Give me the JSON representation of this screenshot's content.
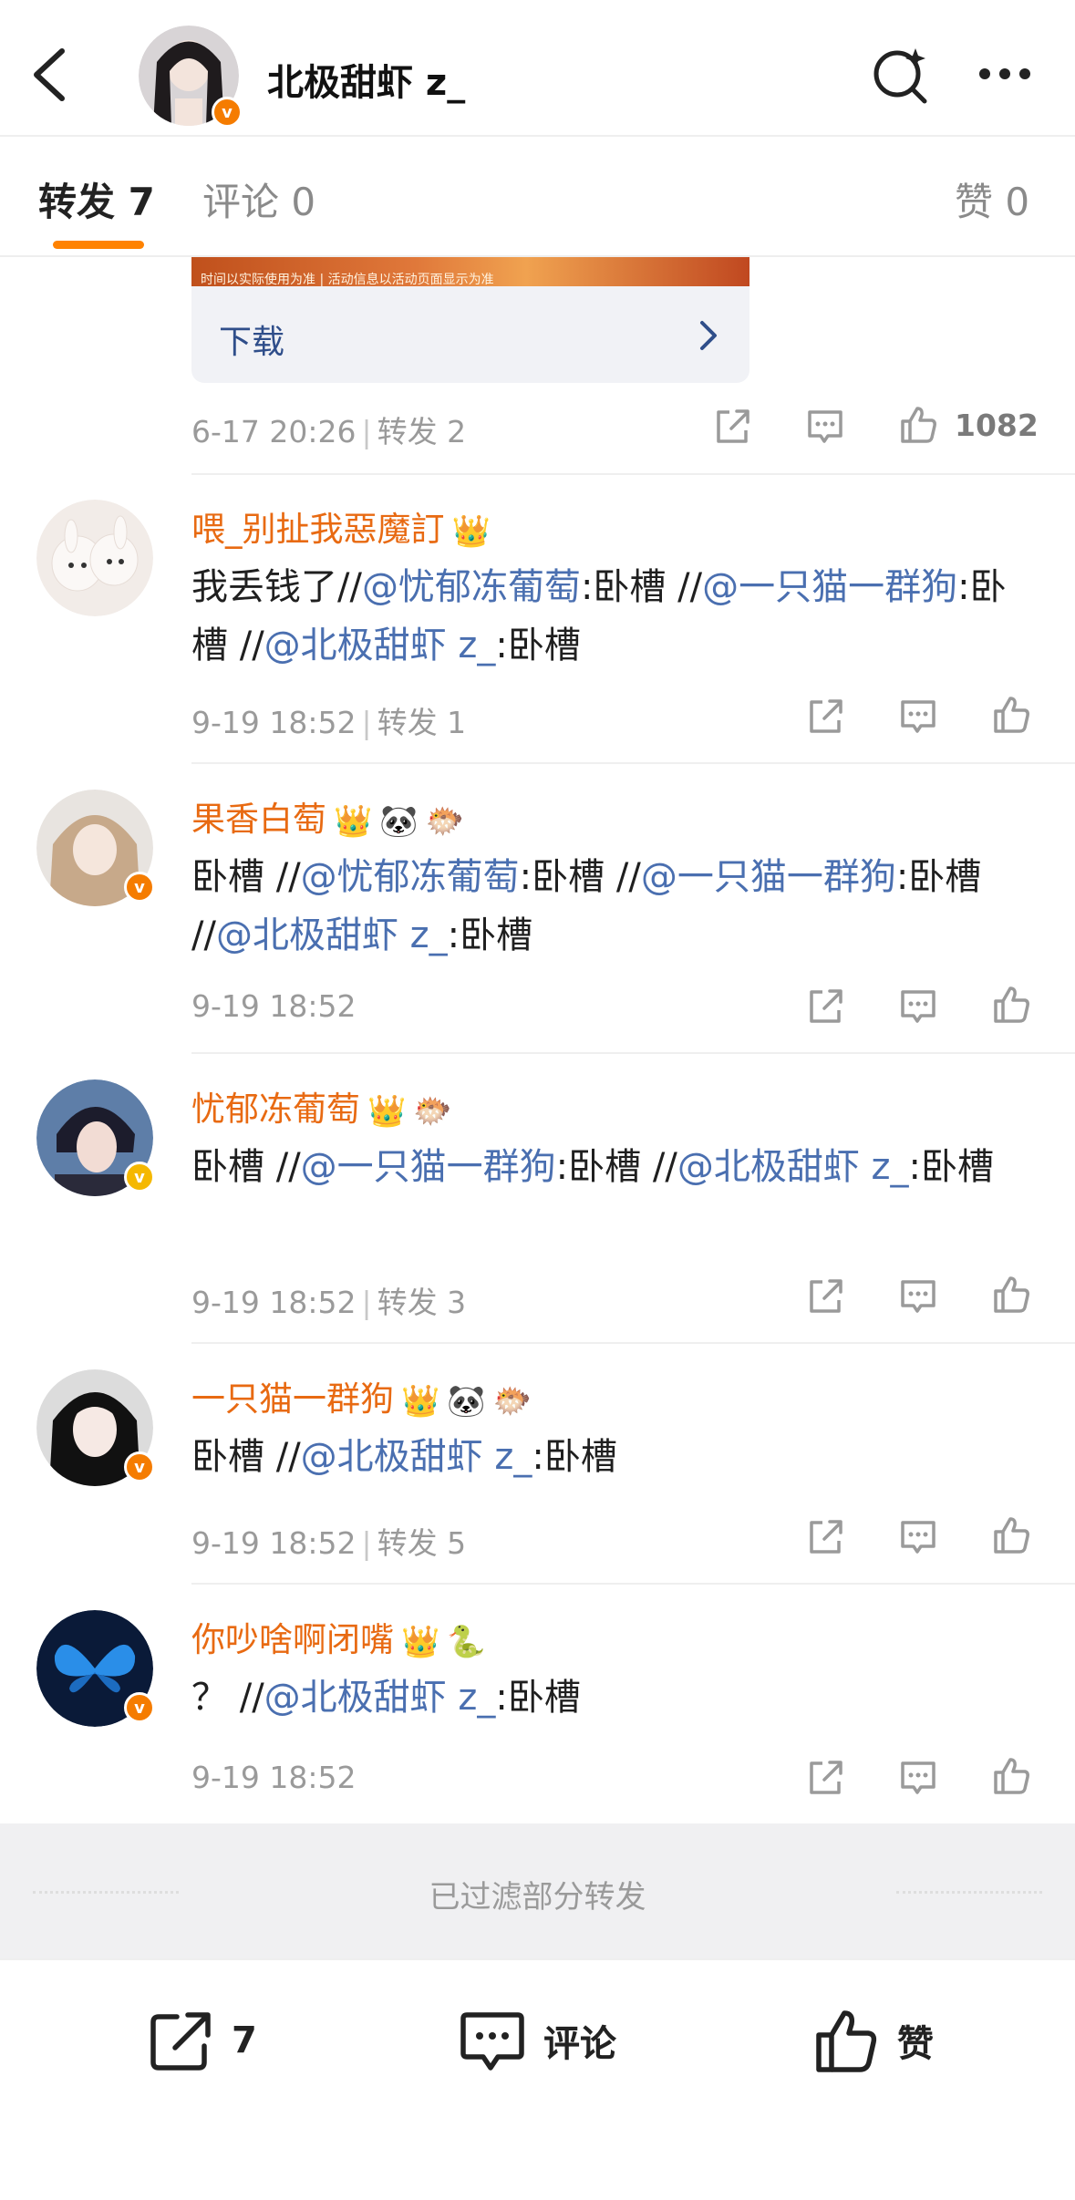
{
  "header": {
    "title": "北极甜虾 z_"
  },
  "tabs": {
    "repost": "转发 7",
    "comment": "评论 0",
    "like": "赞 0"
  },
  "top_card": {
    "image_caption": "时间以实际使用为准 | 活动信息以活动页面显示为准",
    "download_label": "下载",
    "time": "6-17 20:26",
    "reposts": "转发 2",
    "likes": "1082"
  },
  "reposts": [
    {
      "name": "喂_别扯我惡魔訂",
      "badges": [
        "👑"
      ],
      "text_parts": [
        "我丢钱了//",
        "@忧郁冻葡萄",
        ":卧槽 //",
        "@一只猫一群狗",
        ":卧槽 //",
        "@北极甜虾 z_",
        ":卧槽"
      ],
      "time": "9-19 18:52",
      "reposts": "转发 1"
    },
    {
      "name": "果香白萄",
      "badges": [
        "👑",
        "🐼",
        "🐡"
      ],
      "text_parts": [
        "卧槽 //",
        "@忧郁冻葡萄",
        ":卧槽 //",
        "@一只猫一群狗",
        ":卧槽 //",
        "@北极甜虾 z_",
        ":卧槽"
      ],
      "time": "9-19 18:52",
      "reposts": ""
    },
    {
      "name": "忧郁冻葡萄",
      "badges": [
        "👑",
        "🐡"
      ],
      "text_parts": [
        "卧槽 //",
        "@一只猫一群狗",
        ":卧槽 //",
        "@北极甜虾 z_",
        ":卧槽"
      ],
      "time": "9-19 18:52",
      "reposts": "转发 3"
    },
    {
      "name": "一只猫一群狗",
      "badges": [
        "👑",
        "🐼",
        "🐡"
      ],
      "text_parts": [
        "卧槽 //",
        "@北极甜虾 z_",
        ":卧槽"
      ],
      "time": "9-19 18:52",
      "reposts": "转发 5"
    },
    {
      "name": "你吵啥啊闭嘴",
      "badges": [
        "👑",
        "🐍"
      ],
      "text_parts": [
        "？ //",
        "@北极甜虾 z_",
        ":卧槽"
      ],
      "time": "9-19 18:52",
      "reposts": ""
    }
  ],
  "filtered_notice": "已过滤部分转发",
  "bottom_bar": {
    "repost_count": "7",
    "comment_label": "评论",
    "like_label": "赞"
  },
  "colors": {
    "accent": "#ff8200",
    "username": "#e86a12",
    "mention": "#4a6fb0",
    "verified_orange": "#f57c00",
    "verified_gold": "#f5b800"
  }
}
